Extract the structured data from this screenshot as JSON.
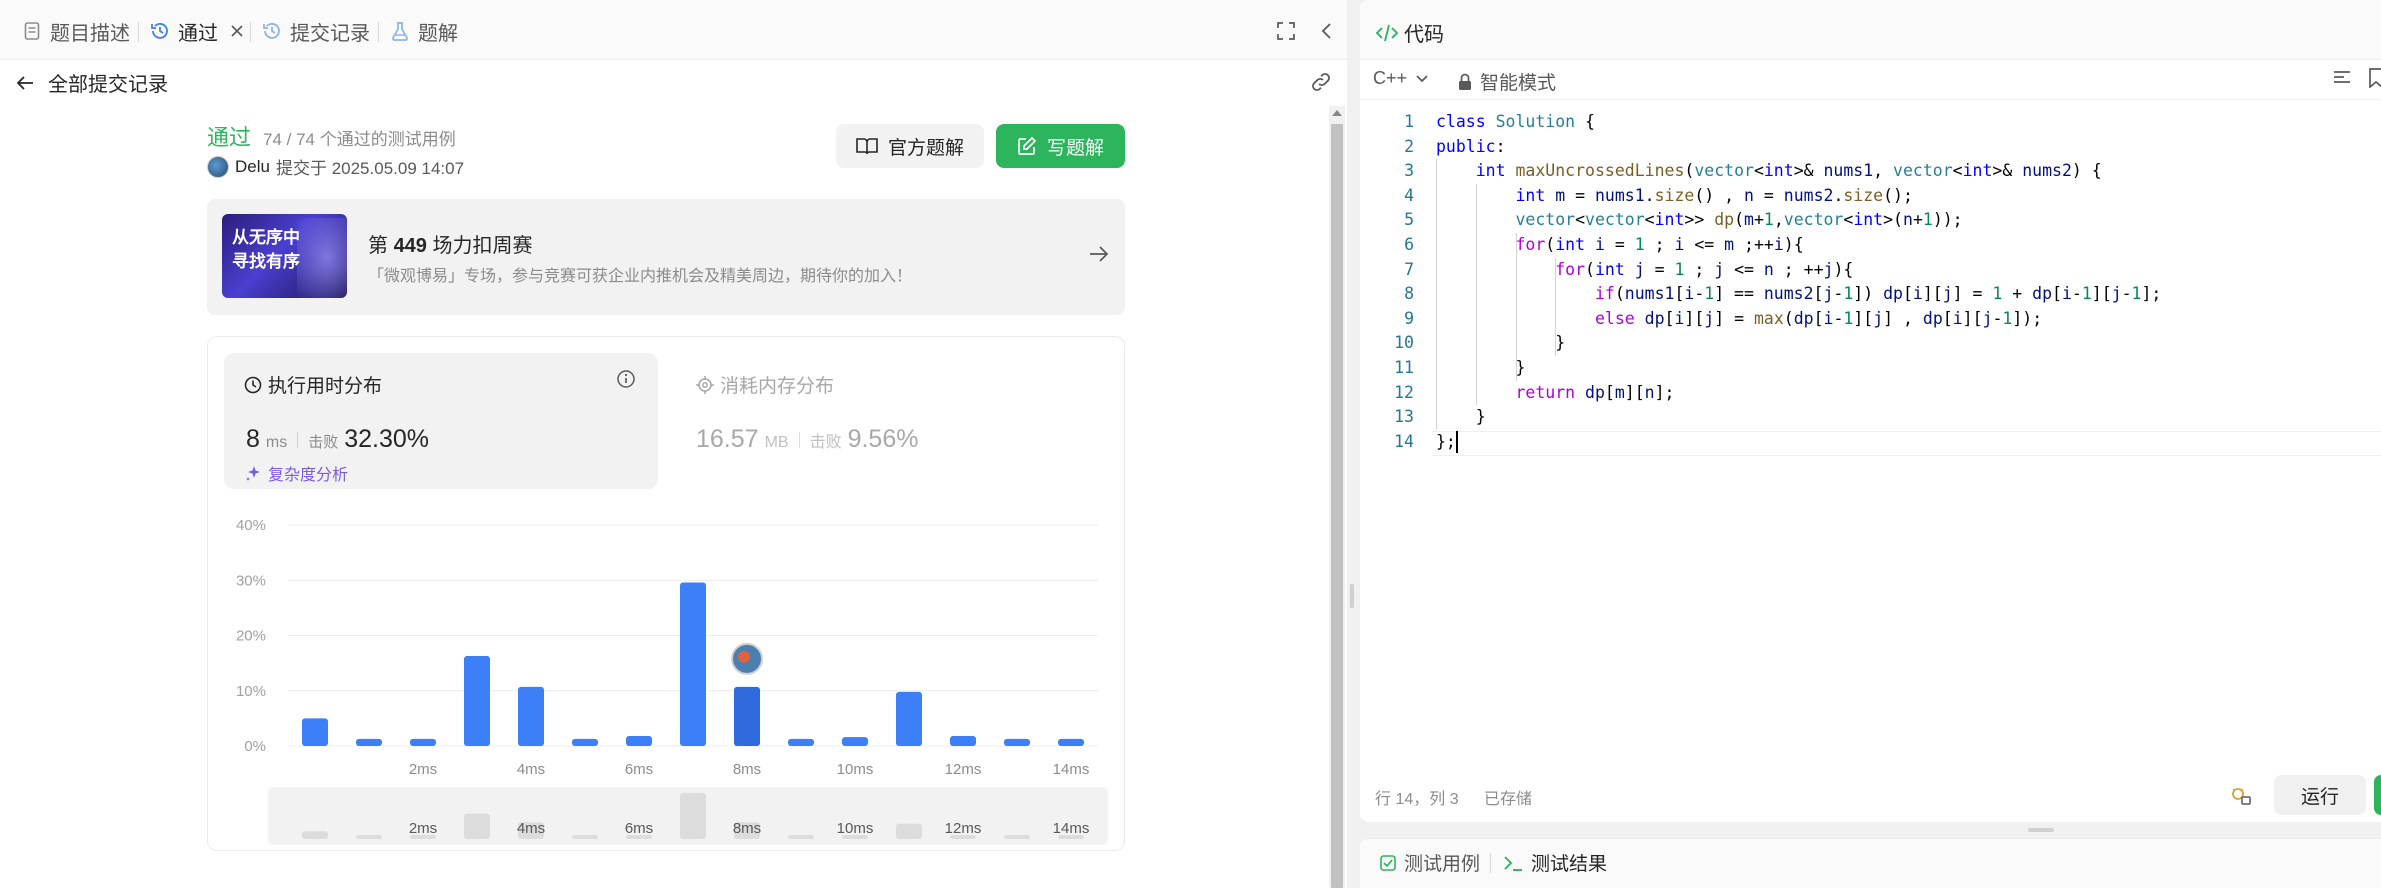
{
  "left_tabs": {
    "description": "题目描述",
    "accepted": "通过",
    "submissions": "提交记录",
    "solutions": "题解"
  },
  "subheader": {
    "back_label": "全部提交记录"
  },
  "submission": {
    "status": "通过",
    "cases": "74 / 74 个通过的测试用例",
    "user": "Delu",
    "submitted_at": "提交于 2025.05.09 14:07",
    "official_btn": "官方题解",
    "write_btn": "写题解"
  },
  "banner": {
    "thumb_line1": "从无序中",
    "thumb_line2": "寻找有序",
    "title_prefix": "第 ",
    "title_num": "449",
    "title_suffix": " 场力扣周赛",
    "desc": "「微观博易」专场，参与竞赛可获企业内推机会及精美周边，期待你的加入！"
  },
  "runtime": {
    "title": "执行用时分布",
    "value": "8",
    "unit": "ms",
    "beat_label": "击败",
    "beat_pct": "32.30%",
    "complexity": "复杂度分析"
  },
  "memory": {
    "title": "消耗内存分布",
    "value": "16.57",
    "unit": "MB",
    "beat_label": "击败",
    "beat_pct": "9.56%"
  },
  "chart_data": {
    "type": "bar",
    "y_ticks": [
      "40%",
      "30%",
      "20%",
      "10%",
      "0%"
    ],
    "ylim": [
      0,
      40
    ],
    "x_tick_labels": [
      "2ms",
      "4ms",
      "6ms",
      "8ms",
      "10ms",
      "12ms",
      "14ms"
    ],
    "values": [
      5,
      1.3,
      1.3,
      16.3,
      10.7,
      1.3,
      1.8,
      29.6,
      10.7,
      1.3,
      1.6,
      9.8,
      1.8,
      1.3,
      1.3
    ],
    "highlight_index": 8,
    "colors": {
      "bar": "#3d7ff6",
      "highlight": "#2f6bde",
      "mini": "#e3e3e3"
    }
  },
  "code_panel": {
    "title": "代码",
    "language": "C++",
    "mode": "智能模式",
    "lines": [
      "class Solution {",
      "public:",
      "    int maxUncrossedLines(vector<int>& nums1, vector<int>& nums2) {",
      "        int m = nums1.size() , n = nums2.size();",
      "        vector<vector<int>> dp(m+1,vector<int>(n+1));",
      "        for(int i = 1 ; i <= m ;++i){",
      "            for(int j = 1 ; j <= n ; ++j){",
      "                if(nums1[i-1] == nums2[j-1]) dp[i][j] = 1 + dp[i-1][j-1];",
      "                else dp[i][j] = max(dp[i-1][j] , dp[i][j-1]);",
      "            }",
      "        }",
      "        return dp[m][n];",
      "    }",
      "};"
    ],
    "cursor_pos": "行 14，列 3",
    "saved": "已存储",
    "run_btn": "运行"
  },
  "bottom_tabs": {
    "testcase": "测试用例",
    "result": "测试结果"
  },
  "partial_code_label": "代码 | C++"
}
